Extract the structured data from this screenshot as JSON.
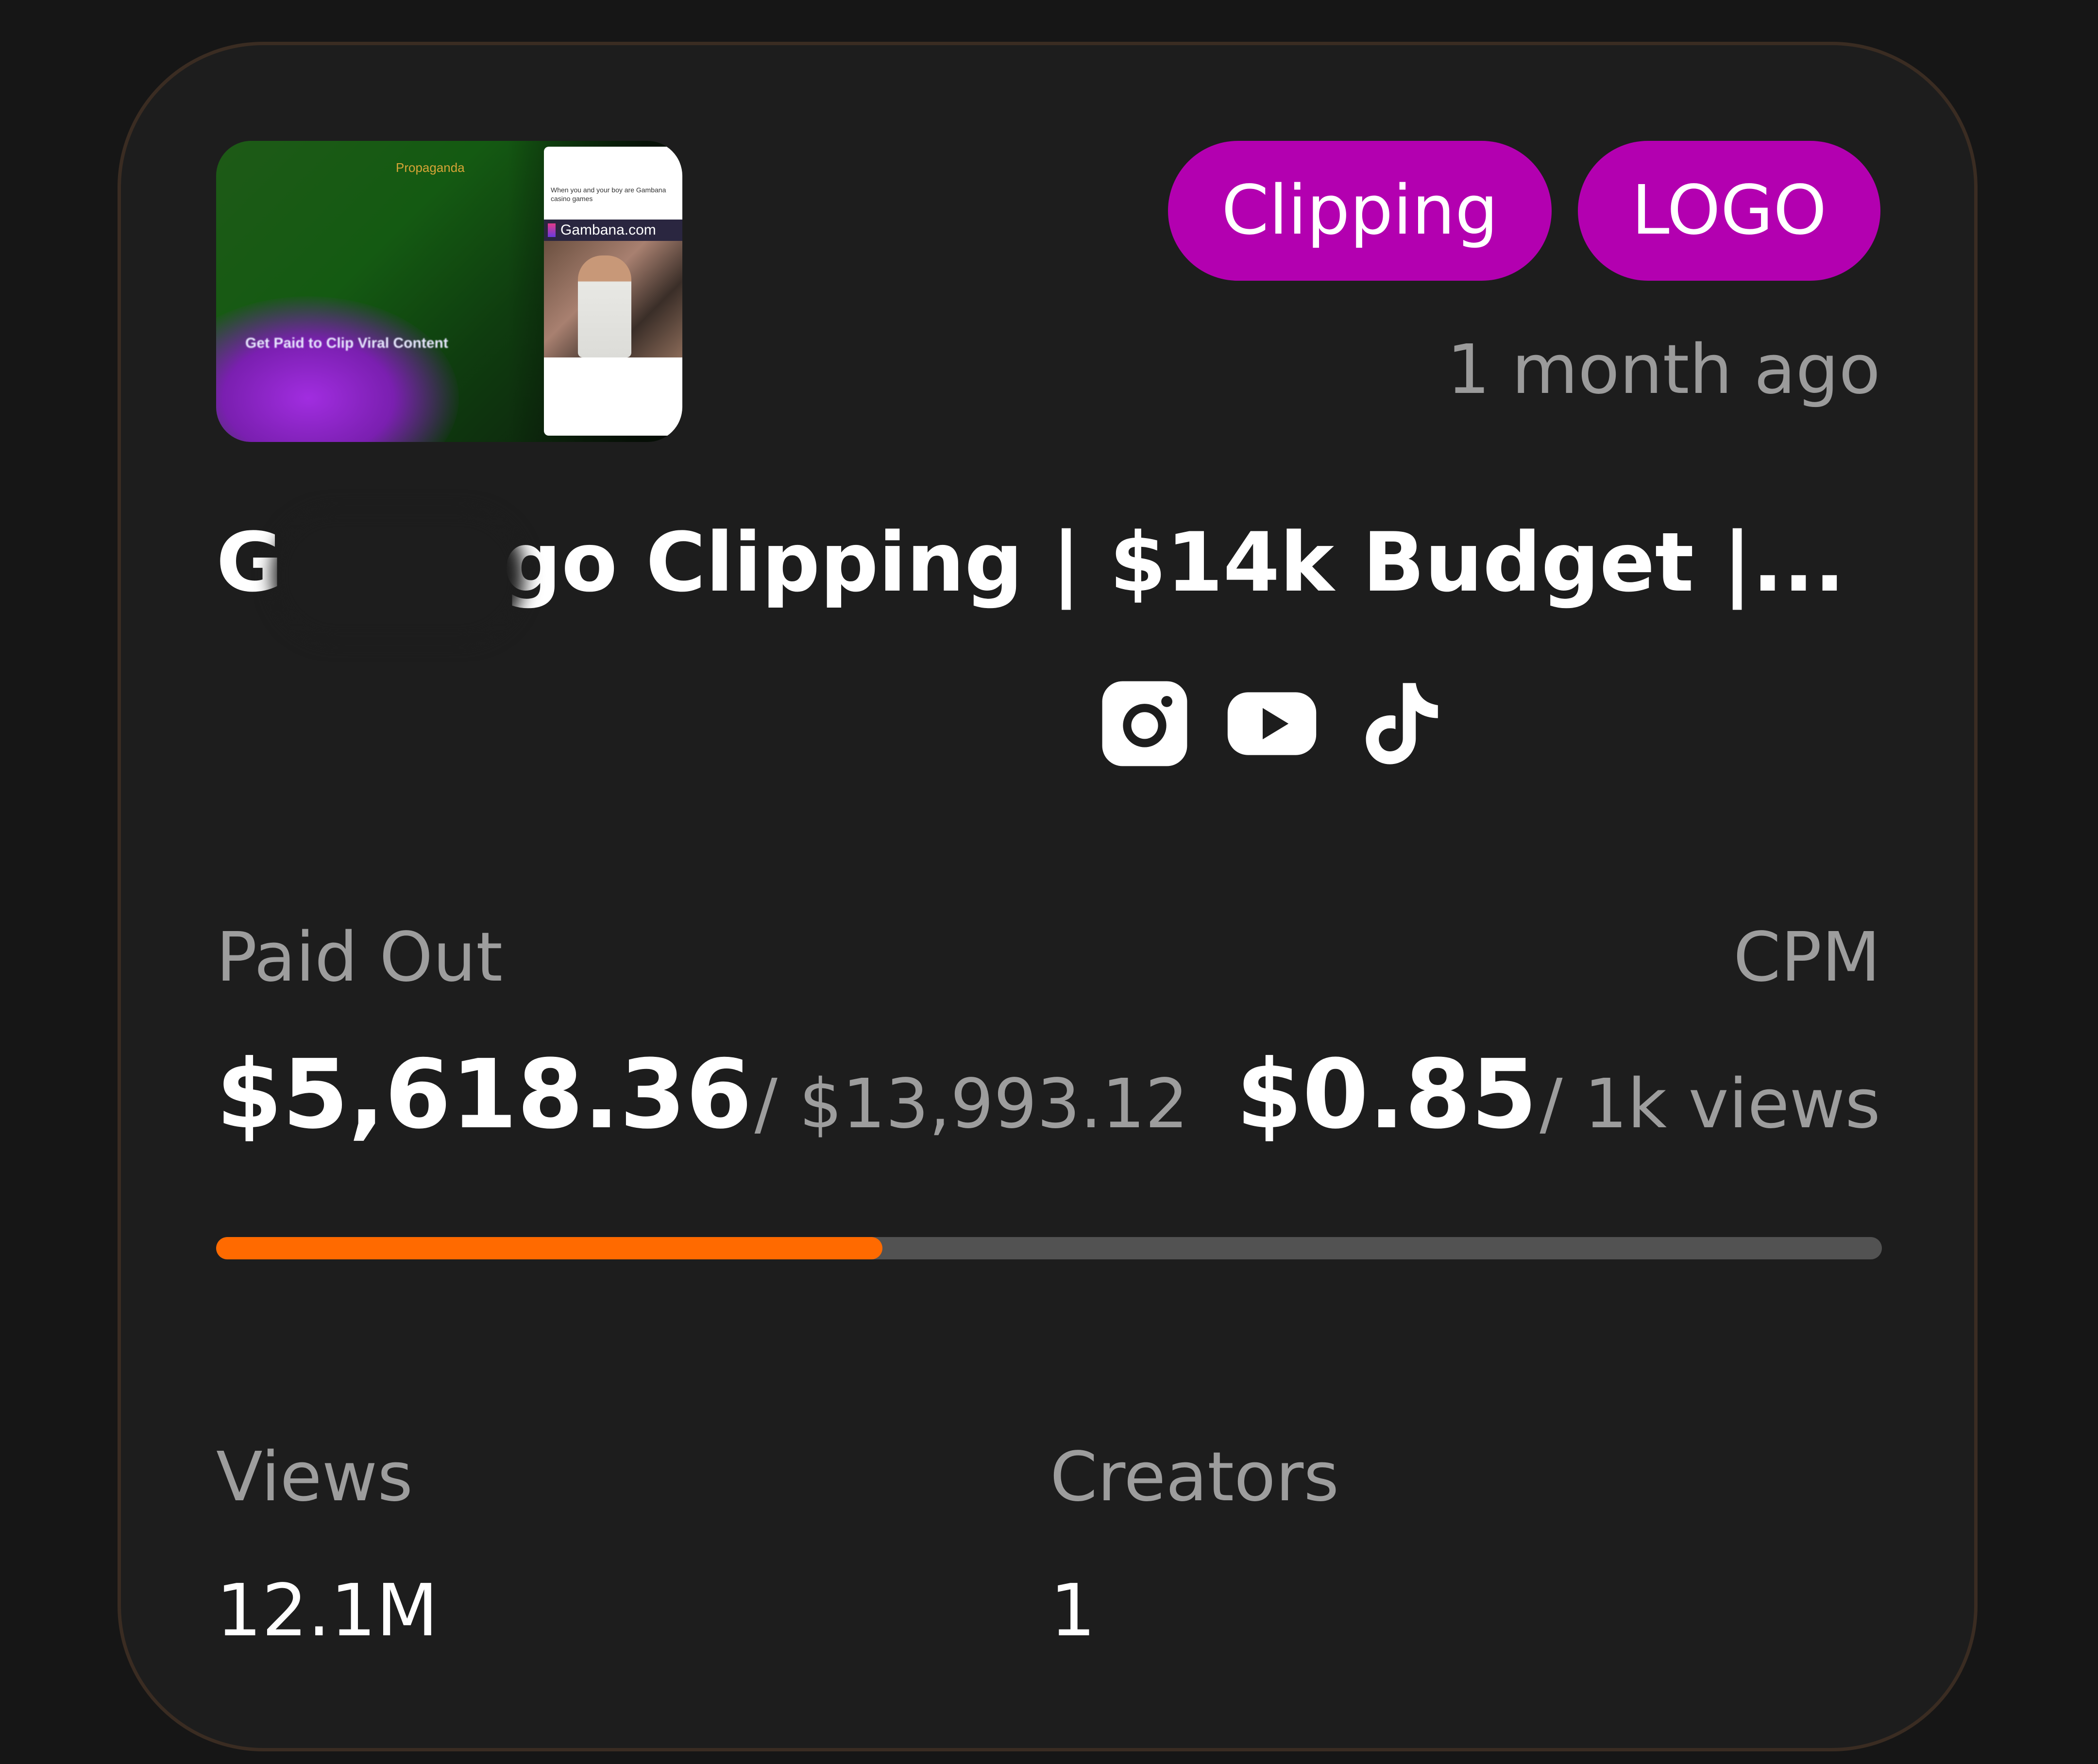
{
  "campaign": {
    "thumbnail": {
      "brand_text": "Propaganda",
      "tagline": "Get Paid to Clip Viral Content",
      "phone_caption": "When you and your boy are Gambana casino games",
      "phone_site": "Gambana.com"
    },
    "tags": [
      "Clipping",
      "LOGO"
    ],
    "posted_ago": "1 month ago",
    "title": "G      a Logo Clipping | $14k Budget |...",
    "platforms": [
      "instagram-icon",
      "youtube-icon",
      "tiktok-icon"
    ],
    "paid_out": {
      "label": "Paid Out",
      "amount": "$5,618.36",
      "total": "/ $13,993.12",
      "progress_fraction": 0.4
    },
    "cpm": {
      "label": "CPM",
      "amount": "$0.85",
      "unit": "/ 1k views"
    },
    "views": {
      "label": "Views",
      "value": "12.1M"
    },
    "creators": {
      "label": "Creators",
      "value": "1"
    }
  },
  "colors": {
    "tag_bg": "#b300b0",
    "progress_fill": "#ff6a00",
    "progress_track": "#525252",
    "card_bg": "#1d1d1d"
  }
}
